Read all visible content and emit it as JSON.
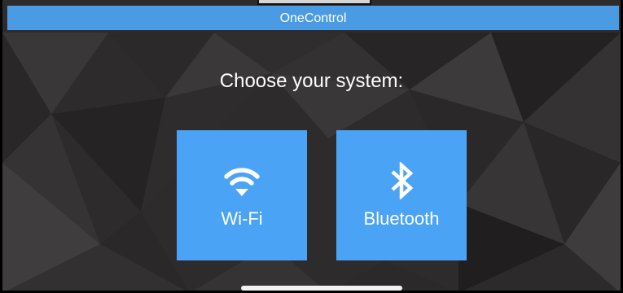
{
  "app": {
    "title": "OneControl"
  },
  "main": {
    "prompt": "Choose your system:",
    "options": [
      {
        "label": "Wi-Fi",
        "icon": "wifi-icon"
      },
      {
        "label": "Bluetooth",
        "icon": "bluetooth-icon"
      }
    ]
  },
  "colors": {
    "accent": "#4a9be3",
    "tile": "#4aa3f5",
    "background": "#2f2c2e"
  }
}
